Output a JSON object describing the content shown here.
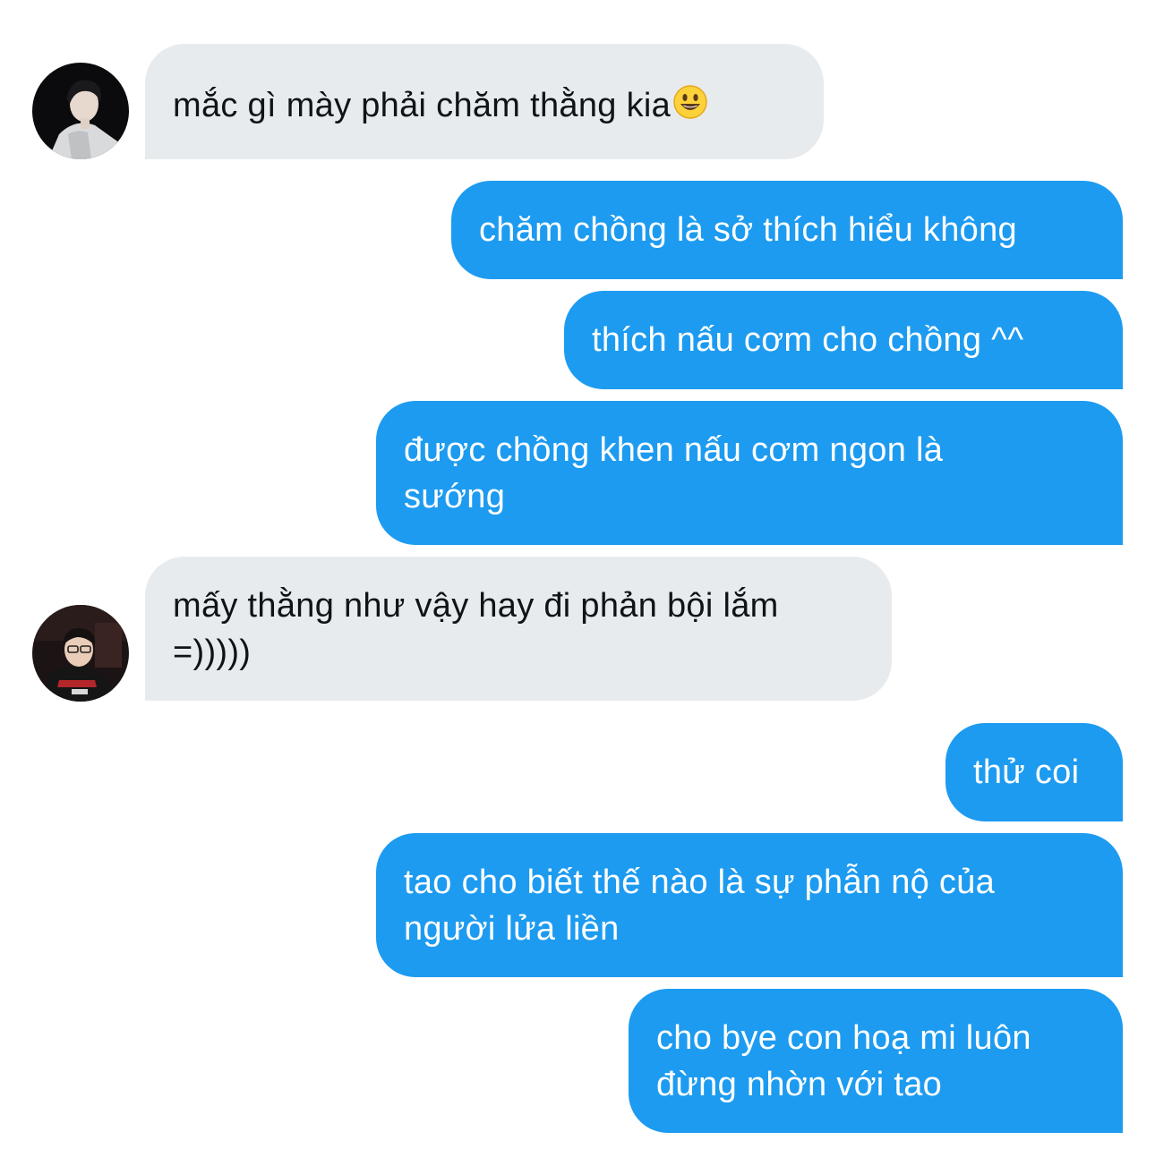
{
  "conversation": {
    "messages": [
      {
        "direction": "incoming",
        "text": "mắc gì mày phải chăm thằng kia",
        "emoji": "smiley-face"
      },
      {
        "direction": "outgoing",
        "text": "chăm chồng là sở thích hiểu không"
      },
      {
        "direction": "outgoing",
        "text": "thích nấu cơm cho chồng ^^"
      },
      {
        "direction": "outgoing",
        "text": "được chồng khen nấu cơm ngon là\nsướng"
      },
      {
        "direction": "incoming",
        "text": "mấy thằng như vậy hay đi phản bội lắm\n=)))))"
      },
      {
        "direction": "outgoing",
        "text": "thử coi"
      },
      {
        "direction": "outgoing",
        "text": "tao cho biết thế nào là sự phẫn nộ của\nngười lửa liền"
      },
      {
        "direction": "outgoing",
        "text": "cho bye con hoạ mi luôn\nđừng nhờn với tao"
      }
    ]
  },
  "colors": {
    "incoming_bubble": "#e8ebee",
    "outgoing_bubble": "#1d9bf0",
    "incoming_text": "#0f1419",
    "outgoing_text": "#ffffff"
  }
}
